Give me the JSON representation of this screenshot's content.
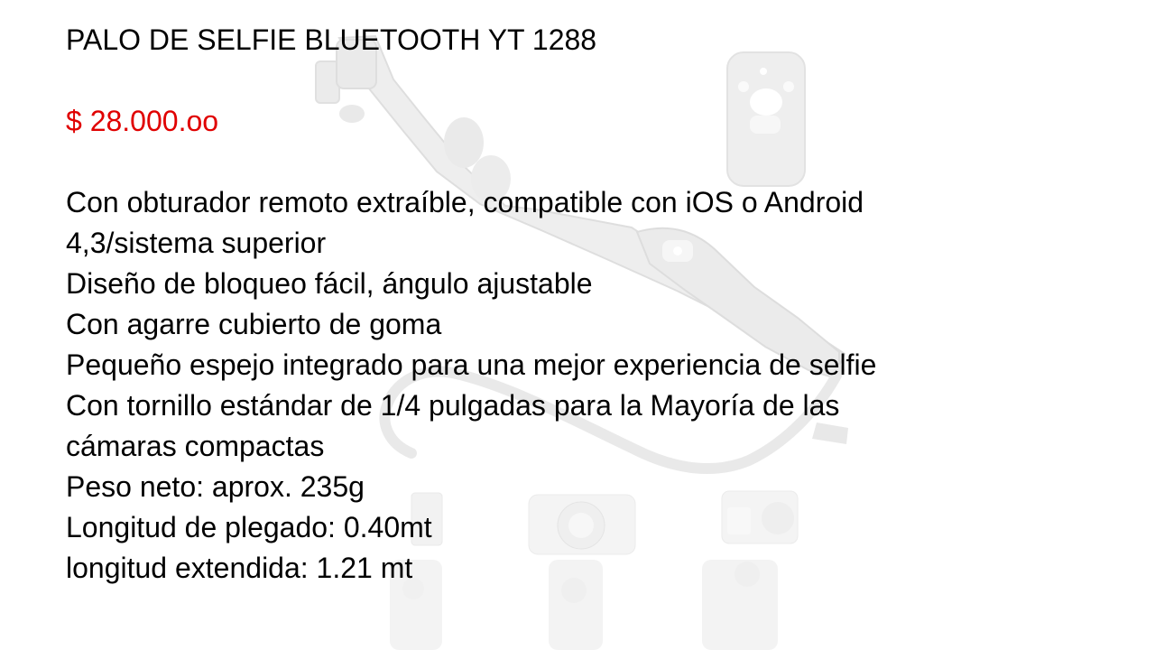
{
  "slide": {
    "title": "PALO DE SELFIE BLUETOOTH YT 1288",
    "price": "$ 28.000.oo",
    "features": [
      "Con obturador remoto extraíble, compatible con iOS o Android",
      "4,3/sistema superior",
      "Diseño de bloqueo fácil, ángulo ajustable",
      "Con agarre cubierto de goma",
      "Pequeño espejo integrado para una mejor experiencia de selfie",
      "Con tornillo estándar de 1/4 pulgadas para la Mayoría de las",
      "cámaras compactas",
      "Peso neto: aprox. 235g",
      "Longitud de plegado: 0.40mt",
      "longitud extendida: 1.21 mt"
    ]
  },
  "colors": {
    "text": "#000000",
    "price": "#e00000",
    "background": "#ffffff",
    "product_image": "#e9e9e9"
  },
  "icons": {
    "background_image": "selfie-stick-product-photo"
  }
}
